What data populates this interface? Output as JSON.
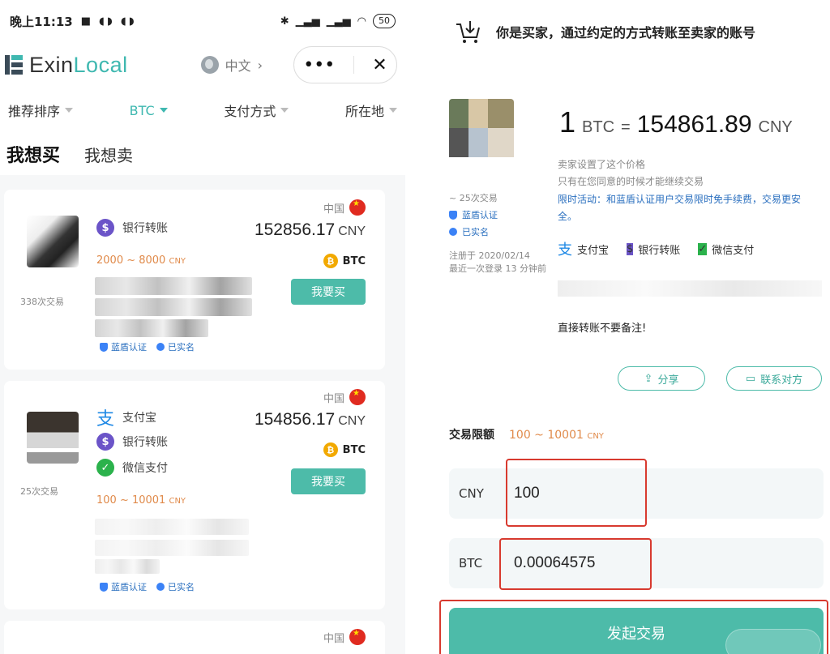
{
  "left": {
    "statusbar": {
      "time": "晚上11:13",
      "battery": "50"
    },
    "app": {
      "logo_exin": "Exin",
      "logo_local": "Local",
      "lang": "中文",
      "menu": "•••",
      "close": "✕"
    },
    "filters": [
      {
        "label": "推荐排序",
        "active": false
      },
      {
        "label": "BTC",
        "active": true
      },
      {
        "label": "支付方式",
        "active": false
      },
      {
        "label": "所在地",
        "active": false
      }
    ],
    "tabs": {
      "buy": "我想买",
      "sell": "我想卖"
    },
    "cards": [
      {
        "country": "中国",
        "payments": [
          {
            "label": "银行转账",
            "icon": "bank-icon"
          }
        ],
        "price": "152856.17",
        "currency": "CNY",
        "limit": "2000 ~ 8000",
        "limit_currency": "CNY",
        "coin": "BTC",
        "button": "我要买",
        "trades": "338次交易",
        "badge_verify": "蓝盾认证",
        "badge_realname": "已实名"
      },
      {
        "country": "中国",
        "payments": [
          {
            "label": "支付宝",
            "icon": "alipay-icon"
          },
          {
            "label": "银行转账",
            "icon": "bank-icon"
          },
          {
            "label": "微信支付",
            "icon": "wechat-icon"
          }
        ],
        "price": "154856.17",
        "currency": "CNY",
        "limit": "100 ~ 10001",
        "limit_currency": "CNY",
        "coin": "BTC",
        "button": "我要买",
        "trades": "25次交易",
        "badge_verify": "蓝盾认证",
        "badge_realname": "已实名"
      },
      {
        "country": "中国"
      }
    ]
  },
  "right": {
    "header": "你是买家，通过约定的方式转账至卖家的账号",
    "seller": {
      "trades": "~ 25次交易",
      "verify": "蓝盾认证",
      "realname": "已实名",
      "registered": "注册于 2020/02/14",
      "last_login": "最近一次登录 13 分钟前"
    },
    "rate": {
      "qty": "1",
      "unit": "BTC",
      "eq": "=",
      "price": "154861.89",
      "currency": "CNY"
    },
    "notes": {
      "line1": "卖家设置了这个价格",
      "line2": "只有在您同意的时候才能继续交易",
      "promo": "限时活动：和蓝盾认证用户交易限时免手续费，交易更安全。"
    },
    "payments": [
      {
        "label": "支付宝",
        "icon": "alipay-icon"
      },
      {
        "label": "银行转账",
        "icon": "bank-icon"
      },
      {
        "label": "微信支付",
        "icon": "wechat-icon"
      }
    ],
    "remark": "直接转账不要备注!",
    "share": "分享",
    "contact": "联系对方",
    "limit": {
      "label": "交易限额",
      "value": "100 ~ 10001",
      "currency": "CNY"
    },
    "cny": {
      "label": "CNY",
      "value": "100"
    },
    "btc": {
      "label": "BTC",
      "value": "0.00064575"
    },
    "submit": "发起交易"
  },
  "colors": {
    "accent": "#4dbba9",
    "limit": "#e08a4a",
    "verify_blue": "#2a6fbf",
    "highlight_red": "#d83a2f"
  }
}
